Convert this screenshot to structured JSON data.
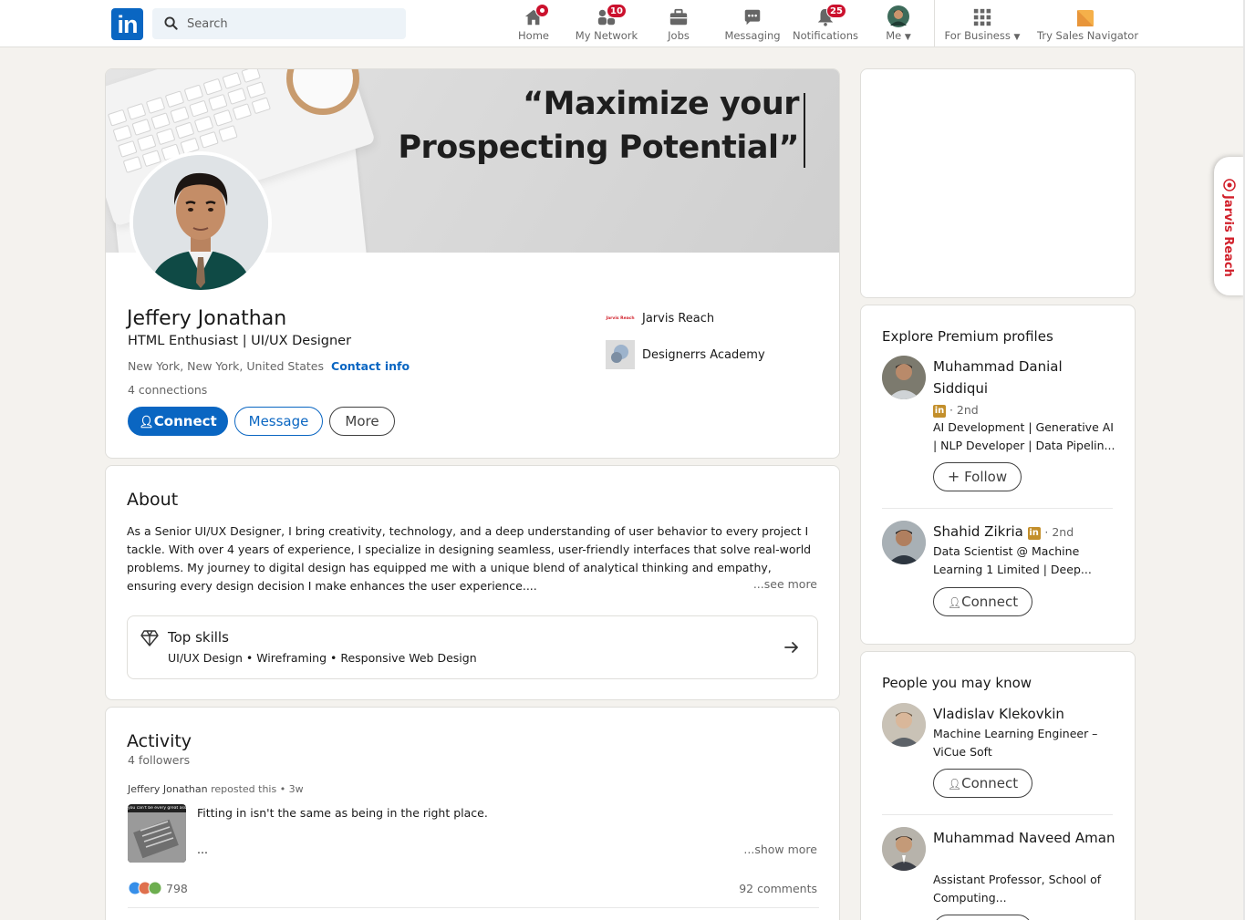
{
  "nav": {
    "search_placeholder": "Search",
    "items": [
      {
        "label": "Home",
        "icon": "home-icon"
      },
      {
        "label": "My Network",
        "icon": "network-icon",
        "badge": "10"
      },
      {
        "label": "Jobs",
        "icon": "briefcase-icon"
      },
      {
        "label": "Messaging",
        "icon": "messaging-icon"
      },
      {
        "label": "Notifications",
        "icon": "bell-icon",
        "badge": "25"
      },
      {
        "label": "Me",
        "icon": "avatar"
      },
      {
        "label": "For Business",
        "icon": "grid-icon"
      },
      {
        "label": "Try Sales Navigator",
        "icon": "sales-navigator-icon"
      }
    ],
    "logo_text": "in"
  },
  "profile": {
    "banner_quote_line1": "“Maximize your",
    "banner_quote_line2": "Prospecting Potential”",
    "name": "Jeffery Jonathan",
    "headline": "HTML Enthusiast | UI/UX Designer",
    "location": "New York, New York, United States",
    "contact_info": "Contact info",
    "connections": "4 connections",
    "buttons": {
      "connect": "Connect",
      "message": "Message",
      "more": "More"
    },
    "orgs": [
      {
        "name": "Jarvis Reach",
        "logo_text": "Jarvis Reach"
      },
      {
        "name": "Designerrs Academy"
      }
    ]
  },
  "about": {
    "title": "About",
    "text": "As a Senior UI/UX Designer, I bring creativity, technology, and a deep understanding of user behavior to every project I tackle. With over 4 years of experience, I specialize in designing seamless, user-friendly interfaces that solve real-world problems. My journey to digital design has equipped me with a unique blend of analytical thinking and empathy, ensuring every design decision I make enhances the user experience....",
    "see_more": "...see more",
    "top_skills_title": "Top skills",
    "top_skills": "UI/UX Design • Wireframing • Responsive Web Design"
  },
  "activity": {
    "title": "Activity",
    "followers": "4 followers",
    "repost_name": "Jeffery Jonathan",
    "repost_meta": "reposted this • 3w",
    "post_text": "Fitting in isn't the same as being in the right place.",
    "post_ellipsis": "...",
    "show_more": "...show more",
    "reaction_count": "798",
    "comments": "92 comments",
    "thumb_caption": "you can't be every great ass"
  },
  "premium": {
    "title": "Explore Premium profiles",
    "people": [
      {
        "name": "Muhammad Danial Siddiqui",
        "degree": "· 2nd",
        "desc": "AI Development | Generative AI | NLP Developer | Data Pipelin...",
        "action": "Follow"
      },
      {
        "name": "Shahid Zikria",
        "degree": "· 2nd",
        "desc": "Data Scientist @ Machine Learning 1 Limited | Deep...",
        "action": "Connect"
      }
    ]
  },
  "pymk": {
    "title": "People you may know",
    "people": [
      {
        "name": "Vladislav Klekovkin",
        "desc": "Machine Learning Engineer – ViCue Soft",
        "action": "Connect"
      },
      {
        "name": "Muhammad Naveed Aman",
        "desc": "Assistant Professor, School of Computing..."
      }
    ]
  },
  "extension": {
    "label": "Jarvis Reach"
  },
  "colors": {
    "brand": "#0a66c2",
    "badge": "#cb112d",
    "premium_gold": "#c38f2b",
    "jarvis_red": "#d11f2a"
  }
}
